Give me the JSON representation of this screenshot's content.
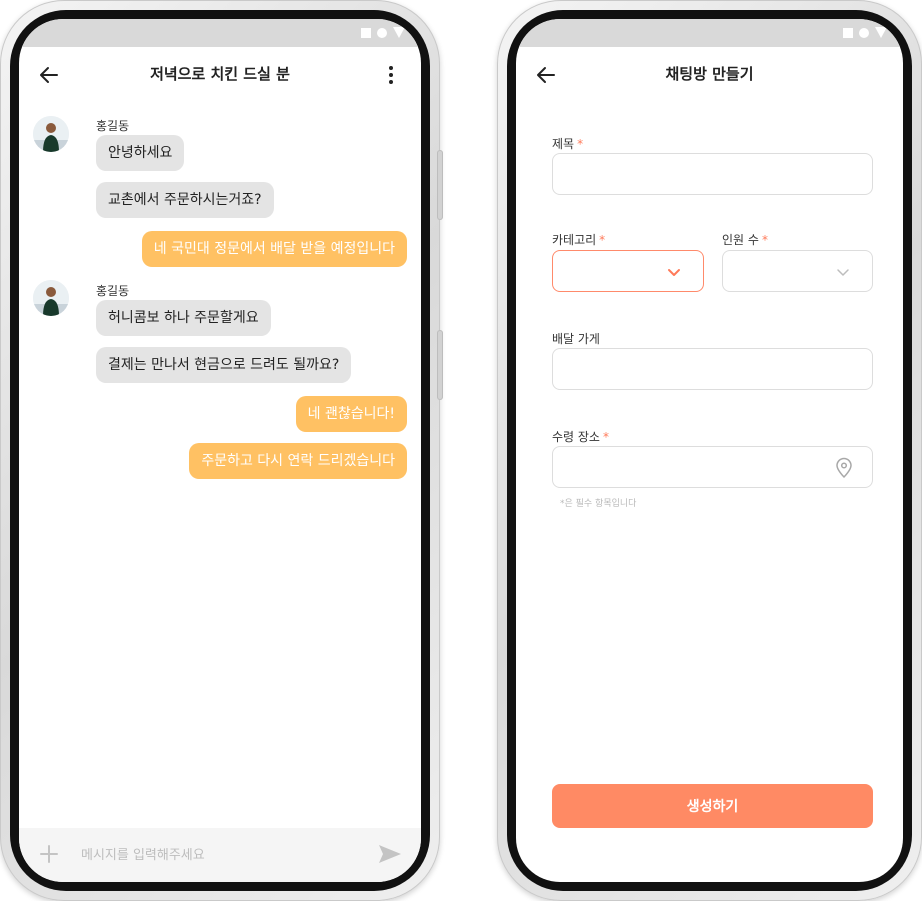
{
  "colors": {
    "accent": "#ff8a64",
    "outgoing_bubble": "#ffc163",
    "incoming_bubble": "#e4e4e4",
    "required_mark": "#ff7a59"
  },
  "chat": {
    "title": "저녁으로 치킨 드실 분",
    "icons": {
      "back": "arrow-left-icon",
      "more": "more-vertical-icon",
      "add": "plus-icon",
      "send": "send-icon"
    },
    "messages": [
      {
        "sender": "홍길동",
        "texts": [
          "안녕하세요",
          "교촌에서 주문하시는거죠?"
        ]
      },
      {
        "me": [
          "네 국민대 정문에서 배달 받을 예정입니다"
        ]
      },
      {
        "sender": "홍길동",
        "texts": [
          "허니콤보 하나 주문할게요",
          "결제는 만나서 현금으로 드려도 될까요?"
        ]
      },
      {
        "me": [
          "네 괜찮습니다!",
          "주문하고 다시 연락 드리겠습니다"
        ]
      }
    ],
    "input": {
      "placeholder": "메시지를 입력해주세요",
      "value": ""
    }
  },
  "form": {
    "title": "채팅방 만들기",
    "fields": {
      "title": {
        "label": "제목",
        "required": "*"
      },
      "category": {
        "label": "카테고리",
        "required": "*"
      },
      "people": {
        "label": "인원 수",
        "required": "*"
      },
      "store": {
        "label": "배달 가게"
      },
      "place": {
        "label": "수령 장소",
        "required": "*"
      }
    },
    "hint": "*은 필수 항목입니다",
    "submit": "생성하기"
  }
}
